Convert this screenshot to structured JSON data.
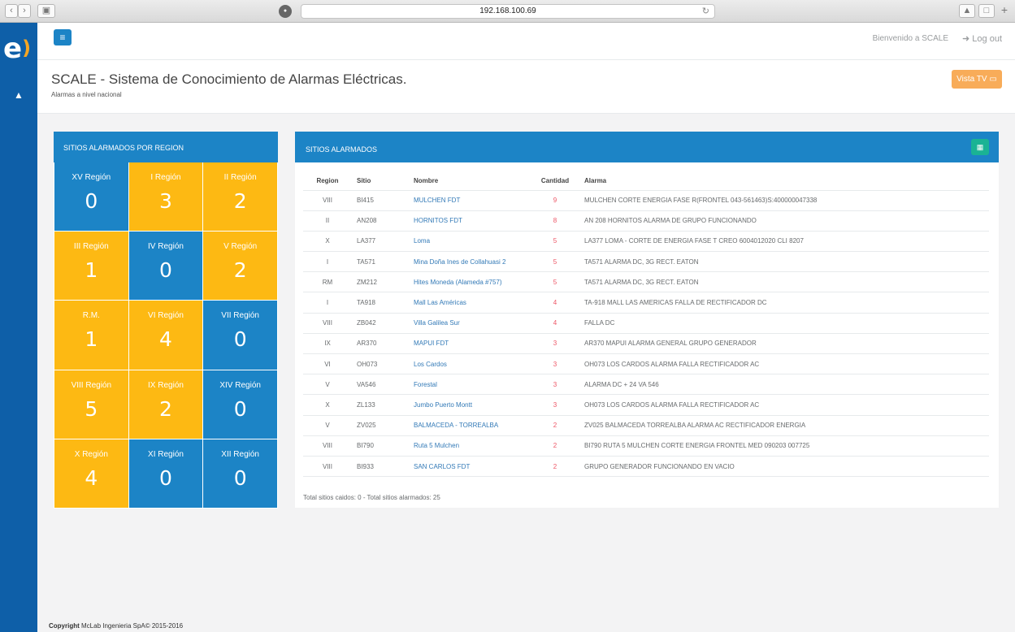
{
  "browser": {
    "url": "192.168.100.69",
    "back_icon": "chevron-left-icon",
    "forward_icon": "chevron-right-icon",
    "sidebar_toggle_icon": "sidebar-icon",
    "reload_icon": "reload-icon"
  },
  "topbar": {
    "welcome": "Bienvenido a SCALE",
    "logout": "Log out"
  },
  "heading": {
    "title": "SCALE - Sistema de Conocimiento de Alarmas Eléctricas.",
    "subtitle": "Alarmas a nivel nacional",
    "tv_button": "Vista TV"
  },
  "regions_panel": {
    "title": "SITIOS ALARMADOS POR REGION",
    "cells": [
      {
        "name": "XV Región",
        "value": "0",
        "color": "blue"
      },
      {
        "name": "I Región",
        "value": "3",
        "color": "yellow"
      },
      {
        "name": "II Región",
        "value": "2",
        "color": "yellow"
      },
      {
        "name": "III Región",
        "value": "1",
        "color": "yellow"
      },
      {
        "name": "IV Región",
        "value": "0",
        "color": "blue"
      },
      {
        "name": "V Región",
        "value": "2",
        "color": "yellow"
      },
      {
        "name": "R.M.",
        "value": "1",
        "color": "yellow"
      },
      {
        "name": "VI Región",
        "value": "4",
        "color": "yellow"
      },
      {
        "name": "VII Región",
        "value": "0",
        "color": "blue"
      },
      {
        "name": "VIII Región",
        "value": "5",
        "color": "yellow"
      },
      {
        "name": "IX Región",
        "value": "2",
        "color": "yellow"
      },
      {
        "name": "XIV Región",
        "value": "0",
        "color": "blue"
      },
      {
        "name": "X Región",
        "value": "4",
        "color": "yellow"
      },
      {
        "name": "XI Región",
        "value": "0",
        "color": "blue"
      },
      {
        "name": "XII Región",
        "value": "0",
        "color": "blue"
      }
    ]
  },
  "sites_panel": {
    "title": "SITIOS ALARMADOS",
    "columns": [
      "Region",
      "Sitio",
      "Nombre",
      "Cantidad",
      "Alarma"
    ],
    "rows": [
      [
        "VIII",
        "BI415",
        "MULCHEN FDT",
        "9",
        "MULCHEN CORTE ENERGIA FASE R(FRONTEL 043-561463)S:400000047338"
      ],
      [
        "II",
        "AN208",
        "HORNITOS FDT",
        "8",
        "AN 208 HORNITOS ALARMA DE GRUPO FUNCIONANDO"
      ],
      [
        "X",
        "LA377",
        "Loma",
        "5",
        "LA377 LOMA - CORTE DE ENERGIA FASE T CREO 6004012020 CLI 8207"
      ],
      [
        "I",
        "TA571",
        "Mina Doña Ines de Collahuasi 2",
        "5",
        "TA571 ALARMA DC, 3G RECT. EATON"
      ],
      [
        "RM",
        "ZM212",
        "Hites Moneda (Alameda #757)",
        "5",
        "TA571 ALARMA DC, 3G RECT. EATON"
      ],
      [
        "I",
        "TA918",
        "Mall Las Américas",
        "4",
        "TA-918 MALL LAS AMERICAS FALLA DE RECTIFICADOR DC"
      ],
      [
        "VIII",
        "ZB042",
        "Villa Galilea Sur",
        "4",
        "FALLA DC"
      ],
      [
        "IX",
        "AR370",
        "MAPUI FDT",
        "3",
        "AR370 MAPUI ALARMA GENERAL GRUPO GENERADOR"
      ],
      [
        "VI",
        "OH073",
        "Los Cardos",
        "3",
        "OH073 LOS CARDOS ALARMA FALLA RECTIFICADOR AC"
      ],
      [
        "V",
        "VA546",
        "Forestal",
        "3",
        "ALARMA DC + 24 VA 546"
      ],
      [
        "X",
        "ZL133",
        "Jumbo Puerto Montt",
        "3",
        "OH073 LOS CARDOS ALARMA FALLA RECTIFICADOR AC"
      ],
      [
        "V",
        "ZV025",
        "BALMACEDA - TORREALBA",
        "2",
        "ZV025 BALMACEDA TORREALBA ALARMA AC RECTIFICADOR ENERGIA"
      ],
      [
        "VIII",
        "BI790",
        "Ruta 5 Mulchen",
        "2",
        "BI790 RUTA 5 MULCHEN CORTE ENERGIA FRONTEL MED 090203 007725"
      ],
      [
        "VIII",
        "BI933",
        "SAN CARLOS FDT",
        "2",
        "GRUPO GENERADOR FUNCIONANDO EN VACIO"
      ]
    ],
    "total": "Total sitios caidos: 0 - Total sitios alarmados: 25"
  },
  "footer": {
    "bold": "Copyright",
    "text": "McLab Ingenieria SpA© 2015-2016"
  },
  "colors": {
    "sidebar": "#0e5fa8",
    "blue": "#1c84c6",
    "yellow": "#fdb913",
    "orange": "#f8ac59",
    "green": "#1ab394",
    "red": "#ed5565",
    "link": "#337ab7"
  }
}
